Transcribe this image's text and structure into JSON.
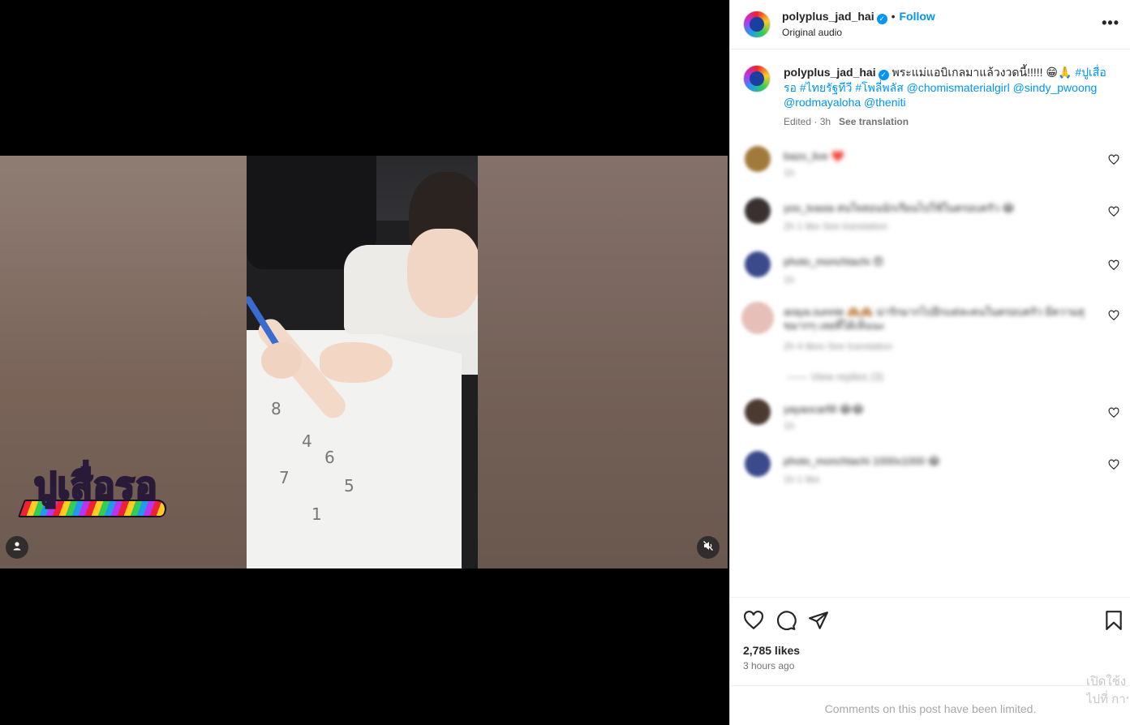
{
  "post": {
    "username": "polyplus_jad_hai",
    "audio": "Original audio",
    "follow_label": "Follow",
    "dot": "•",
    "more_label": "•••"
  },
  "caption": {
    "username": "polyplus_jad_hai",
    "text": "พระแม่แอบิเกลมาแล้วงวดนี้!!!!! 😁🙏",
    "hashtag1": "#ปูเสื่อรอ",
    "hashtag2": "#ไทยรัฐทีวี",
    "hashtag3": "#โพลี่พลัส",
    "mention1": "@chomismaterialgirl",
    "mention2": "@sindy_pwoong",
    "mention3": "@rodmayaloha",
    "mention4": "@theniti",
    "meta": "Edited · 3h",
    "see_translation": "See translation"
  },
  "comments": [
    {
      "text": "bazo_live ❤️",
      "meta": "1h"
    },
    {
      "text": "yoo_tvasia สนใจสอนนักเรียนไปใช้ในครอบครัว 😂",
      "meta": "2h   1 like   See translation"
    },
    {
      "text": "photo_monchtachi 😍",
      "meta": "1h"
    },
    {
      "text": "araya.sunnie 🙈🙈 น่ารักมากไปอีกแต่ละคนในครอบครัว มีความสุขมากๆ เลยที่ได้เห็นนะ",
      "meta": "2h   4 likes   See translation"
    },
    {
      "text": "—— View replies (3)",
      "meta": ""
    },
    {
      "text": "yayaocarfill 😂😂",
      "meta": "1h"
    },
    {
      "text": "photo_monchtachi 1000x1000 😂",
      "meta": "1h   1 like"
    }
  ],
  "video": {
    "logo_text": "ปูเสื่อรอ",
    "scribbles": [
      "8",
      "4",
      "6",
      "7",
      "5",
      "1"
    ]
  },
  "actions": {
    "likes": "2,785 likes",
    "time": "3 hours ago"
  },
  "footer": {
    "limited": "Comments on this post have been limited.",
    "activate_line1": "เปิดใช้ง",
    "activate_line2": "ไปที่ การ"
  },
  "colors": {
    "accent": "#0095f6",
    "text": "#262626",
    "muted": "#737373"
  },
  "icons": [
    "more-icon",
    "verified-icon",
    "heart-icon",
    "comment-icon",
    "share-icon",
    "save-icon",
    "mute-icon",
    "user-tag-icon"
  ]
}
